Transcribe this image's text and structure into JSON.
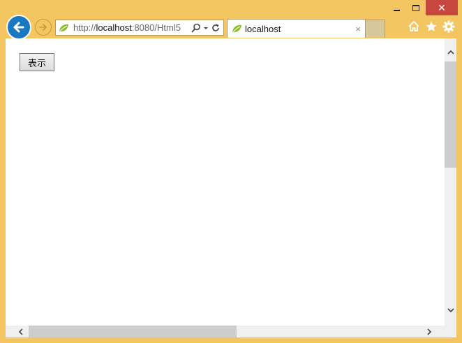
{
  "window": {
    "controls": {
      "minimize_label": "",
      "maximize_label": "",
      "close_label": "✕"
    }
  },
  "address_bar": {
    "url_scheme": "http://",
    "url_host": "localhost",
    "url_rest": ":8080/Html5"
  },
  "tab": {
    "title": "localhost",
    "close_label": "×"
  },
  "page": {
    "show_button_label": "表示"
  },
  "icons": {
    "back": "back-arrow-icon",
    "forward": "forward-arrow-icon",
    "site": "leaf-icon",
    "search": "search-icon",
    "dropdown": "chevron-down-icon",
    "refresh": "refresh-icon",
    "home": "home-icon",
    "favorites": "star-icon",
    "settings": "gear-icon"
  },
  "colors": {
    "frame": "#f3c661",
    "back_button": "#1a78c2",
    "close_button": "#c7463e",
    "site_leaf": "#8dbb2c"
  }
}
